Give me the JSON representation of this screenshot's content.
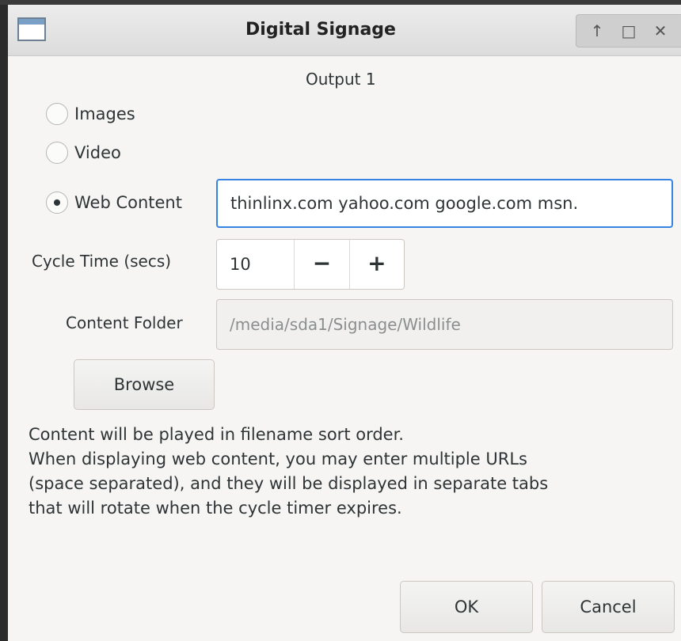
{
  "window": {
    "title": "Digital Signage",
    "controls": [
      "↑",
      "□",
      "✕"
    ]
  },
  "output": {
    "label": "Output 1"
  },
  "source": {
    "options": [
      {
        "label": "Images",
        "checked": false
      },
      {
        "label": "Video",
        "checked": false
      },
      {
        "label": "Web Content",
        "checked": true
      }
    ],
    "web_urls": "thinlinx.com yahoo.com google.com msn."
  },
  "cycle": {
    "label": "Cycle Time (secs)",
    "value": "10",
    "minus": "−",
    "plus": "+"
  },
  "folder": {
    "label": "Content Folder",
    "placeholder": "/media/sda1/Signage/Wildlife"
  },
  "browse_label": "Browse",
  "info_lines": [
    "Content will be played in filename sort order.",
    "When displaying web content, you may enter multiple URLs",
    "(space separated), and they will be displayed in separate tabs",
    "that will rotate when the cycle timer expires."
  ],
  "buttons": {
    "ok": "OK",
    "cancel": "Cancel"
  }
}
